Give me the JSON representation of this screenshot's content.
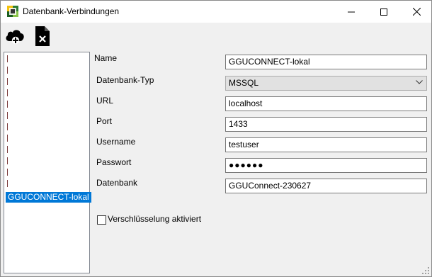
{
  "window": {
    "title": "Datenbank-Verbindungen",
    "icons": {
      "app": "app-icon",
      "minimize": "minimize-icon",
      "maximize": "maximize-icon",
      "close": "close-icon"
    }
  },
  "toolbar": {
    "add_icon": "cloud-add-icon",
    "delete_icon": "file-delete-icon"
  },
  "connections": {
    "selected_label": "GGUCONNECT-lokal"
  },
  "form": {
    "name_label": "Name",
    "name_value": "GGUCONNECT-lokal",
    "type_label": "Datenbank-Typ",
    "type_value": "MSSQL",
    "url_label": "URL",
    "url_value": "localhost",
    "port_label": "Port",
    "port_value": "1433",
    "username_label": "Username",
    "username_value": "testuser",
    "password_label": "Passwort",
    "password_value": "●●●●●●",
    "database_label": "Datenbank",
    "database_value": "GGUConnect-230627",
    "encryption_label": "Verschlüsselung aktiviert",
    "encryption_checked": false
  },
  "colors": {
    "selection": "#0078d7",
    "window_bg": "#f0f0f0",
    "select_bg": "#e1e1e1"
  }
}
